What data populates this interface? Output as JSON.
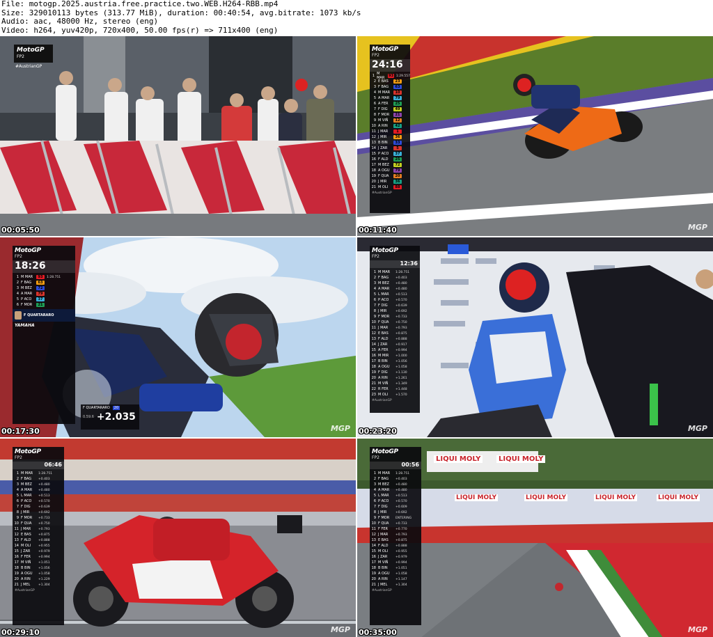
{
  "info": {
    "file": "File: motogp.2025.austria.free.practice.two.WEB.H264-RBB.mp4",
    "size": "Size: 329010113 bytes (313.77 MiB), duration: 00:40:54, avg.bitrate: 1073 kb/s",
    "audio": "Audio: aac, 48000 Hz, stereo (eng)",
    "video": "Video: h264, yuv420p, 720x400, 50.00 fps(r) => 711x400 (eng)"
  },
  "brand": {
    "logo": "MotoGP",
    "session": "FP2",
    "hashtag": "#AustrianGP",
    "watermark": "MGP"
  },
  "tiles": [
    {
      "timestamp": "00:05:50",
      "scene": "crowd-grandstand"
    },
    {
      "timestamp": "00:11:40",
      "scene": "ktm-on-track",
      "clock": "24:16",
      "rows": [
        [
          "1",
          "M MAR",
          "93",
          "1:29.557"
        ],
        [
          "2",
          "E BAS",
          "23",
          ""
        ],
        [
          "3",
          "F BAG",
          "63",
          ""
        ],
        [
          "4",
          "M MAR",
          "10",
          ""
        ],
        [
          "5",
          "A MAR",
          "79",
          ""
        ],
        [
          "6",
          "A FER",
          "25",
          ""
        ],
        [
          "7",
          "F DIG",
          "49",
          ""
        ],
        [
          "8",
          "F MOR",
          "21",
          ""
        ],
        [
          "9",
          "M VIŇ",
          "12",
          ""
        ],
        [
          "10",
          "A RIN",
          "42",
          ""
        ],
        [
          "11",
          "J MAR",
          "1",
          ""
        ],
        [
          "12",
          "J MIR",
          "36",
          ""
        ],
        [
          "13",
          "B BIN",
          "33",
          ""
        ],
        [
          "14",
          "J ZAR",
          "5",
          ""
        ],
        [
          "15",
          "P ACO",
          "37",
          ""
        ],
        [
          "16",
          "F ALD",
          "25",
          ""
        ],
        [
          "17",
          "M BEZ",
          "72",
          ""
        ],
        [
          "18",
          "A OGU",
          "79",
          ""
        ],
        [
          "19",
          "F QUA",
          "20",
          ""
        ],
        [
          "20",
          "J MIR",
          "36",
          ""
        ],
        [
          "21",
          "M OLI",
          "88",
          ""
        ]
      ]
    },
    {
      "timestamp": "00:17:30",
      "scene": "yamaha-onboard",
      "clock": "18:26",
      "rider": "F QUARTARARO",
      "team": "YAMAHA",
      "gap": "+2.035",
      "num": "20",
      "lapsplit": "0.59.6",
      "rows": [
        [
          "1",
          "M MAR",
          "93",
          "1:28.751"
        ],
        [
          "2",
          "F BAG",
          "63",
          ""
        ],
        [
          "3",
          "M BEZ",
          "72",
          ""
        ],
        [
          "4",
          "A MAR",
          "79",
          ""
        ],
        [
          "5",
          "P ACO",
          "37",
          ""
        ],
        [
          "6",
          "F MOR",
          "21",
          ""
        ]
      ]
    },
    {
      "timestamp": "00:23:20",
      "scene": "pit-box",
      "clock": "12:36",
      "rows": [
        [
          "1",
          "M MAR",
          "",
          "1:28.751"
        ],
        [
          "2",
          "F BAG",
          "",
          "+0.403"
        ],
        [
          "3",
          "M BEZ",
          "",
          "+0.480"
        ],
        [
          "4",
          "A MAR",
          "",
          "+0.480"
        ],
        [
          "5",
          "L MAR",
          "",
          "+0.513"
        ],
        [
          "6",
          "P ACO",
          "",
          "+0.570"
        ],
        [
          "7",
          "F DIG",
          "",
          "+0.639"
        ],
        [
          "8",
          "J MIR",
          "",
          "+0.692"
        ],
        [
          "9",
          "F MOR",
          "",
          "+0.733"
        ],
        [
          "10",
          "F QUA",
          "",
          "+0.750"
        ],
        [
          "11",
          "J MAR",
          "",
          "+0.793"
        ],
        [
          "12",
          "E BAS",
          "",
          "+0.875"
        ],
        [
          "13",
          "F ALD",
          "",
          "+0.888"
        ],
        [
          "14",
          "J ZAR",
          "",
          "+0.917"
        ],
        [
          "15",
          "A FER",
          "",
          "+0.994"
        ],
        [
          "16",
          "M MIR",
          "",
          "+1.000"
        ],
        [
          "17",
          "B BIN",
          "",
          "+1.056"
        ],
        [
          "18",
          "A OGU",
          "",
          "+1.058"
        ],
        [
          "19",
          "F DIG",
          "",
          "+1.130"
        ],
        [
          "20",
          "A RIN",
          "",
          "+1.261"
        ],
        [
          "21",
          "M VIŇ",
          "",
          "+1.349"
        ],
        [
          "22",
          "R FER",
          "",
          "+1.448"
        ],
        [
          "23",
          "M OLI",
          "",
          "+1.570"
        ]
      ]
    },
    {
      "timestamp": "00:29:10",
      "scene": "honda-motion-blur",
      "clock": "06:46",
      "rows": [
        [
          "1",
          "M MAR",
          "",
          "1:28.751"
        ],
        [
          "2",
          "F BAG",
          "",
          "+0.403"
        ],
        [
          "3",
          "M BEZ",
          "",
          "+0.480"
        ],
        [
          "4",
          "A MAR",
          "",
          "+0.480"
        ],
        [
          "5",
          "L MAR",
          "",
          "+0.513"
        ],
        [
          "6",
          "P ACO",
          "",
          "+0.570"
        ],
        [
          "7",
          "F DIG",
          "",
          "+0.639"
        ],
        [
          "8",
          "J MIR",
          "",
          "+0.692"
        ],
        [
          "9",
          "F MOR",
          "",
          "+0.733"
        ],
        [
          "10",
          "F QUA",
          "",
          "+0.750"
        ],
        [
          "11",
          "J MAR",
          "",
          "+0.793"
        ],
        [
          "12",
          "E BAS",
          "",
          "+0.875"
        ],
        [
          "13",
          "F ALD",
          "",
          "+0.888"
        ],
        [
          "14",
          "M OLI",
          "",
          "+0.955"
        ],
        [
          "15",
          "J ZAR",
          "",
          "+0.979"
        ],
        [
          "16",
          "F FER",
          "",
          "+0.994"
        ],
        [
          "17",
          "M VIŇ",
          "",
          "+1.051"
        ],
        [
          "18",
          "B BIN",
          "",
          "+1.056"
        ],
        [
          "19",
          "A OGU",
          "",
          "+1.058"
        ],
        [
          "20",
          "A RIN",
          "",
          "+1.229"
        ],
        [
          "21",
          "J MEL",
          "",
          "+1.304"
        ]
      ]
    },
    {
      "timestamp": "00:35:00",
      "scene": "liqui-moly-corner",
      "clock": "00:56",
      "sponsor": "LIQUI MOLY",
      "rows": [
        [
          "1",
          "M MAR",
          "",
          "1:28.751"
        ],
        [
          "2",
          "F BAG",
          "",
          "+0.403"
        ],
        [
          "3",
          "M BEZ",
          "",
          "+0.480"
        ],
        [
          "4",
          "A MAR",
          "",
          "+0.480"
        ],
        [
          "5",
          "L MAR",
          "",
          "+0.513"
        ],
        [
          "6",
          "P ACO",
          "",
          "+0.570"
        ],
        [
          "7",
          "F DIG",
          "",
          "+0.609"
        ],
        [
          "8",
          "J MIR",
          "",
          "+0.692"
        ],
        [
          "9",
          "F MOR",
          "",
          "ENTERING"
        ],
        [
          "10",
          "F QUA",
          "",
          "+0.733"
        ],
        [
          "11",
          "F FER",
          "",
          "+0.770"
        ],
        [
          "12",
          "J MAR",
          "",
          "+0.793"
        ],
        [
          "13",
          "E BAS",
          "",
          "+0.875"
        ],
        [
          "14",
          "F ALD",
          "",
          "+0.888"
        ],
        [
          "15",
          "M OLI",
          "",
          "+0.955"
        ],
        [
          "16",
          "J ZAR",
          "",
          "+0.979"
        ],
        [
          "17",
          "M VIŇ",
          "",
          "+0.994"
        ],
        [
          "18",
          "B BIN",
          "",
          "+1.051"
        ],
        [
          "19",
          "A OGU",
          "",
          "+1.058"
        ],
        [
          "20",
          "A RIN",
          "",
          "+1.147"
        ],
        [
          "21",
          "J MEL",
          "",
          "+1.304"
        ]
      ]
    }
  ],
  "colors": {
    "tower_bg": "#0a0a0e",
    "header_text": "#000000"
  }
}
